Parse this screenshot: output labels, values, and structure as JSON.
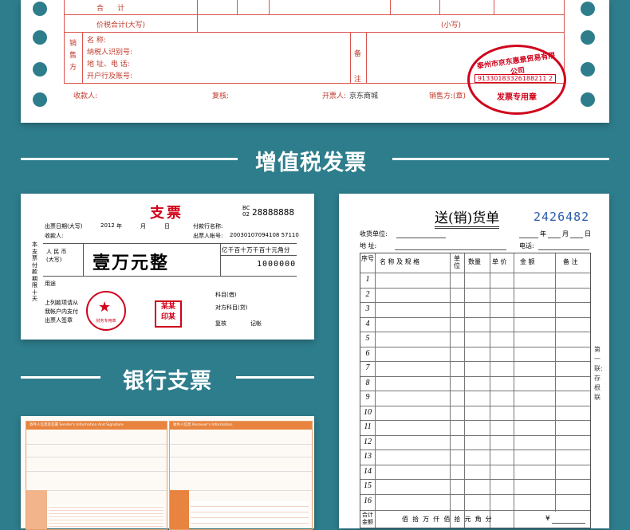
{
  "invoice": {
    "row_total": "合      计",
    "row_tax_total": "价税合计(大写)",
    "row_small": "(小写)",
    "seller_label": [
      "销",
      "售",
      "方"
    ],
    "fields": [
      "名        称:",
      "纳税人识别号:",
      "地  址、电 话:",
      "开户行及账号:"
    ],
    "remark_label": [
      "备",
      "注"
    ],
    "receiver": "收款人:",
    "reviewer": "复核:",
    "issuer": "开票人:",
    "issuer_name": "京东商城",
    "seller_stamp": "销售方:(章)",
    "stamp_top": "泰州市京东惠景贸易有限公司",
    "stamp_id": "91330183326188211 2",
    "stamp_bottom": "发票专用章"
  },
  "section_titles": {
    "vat": "增值税发票",
    "cheque": "银行支票"
  },
  "cheque": {
    "title": "支票",
    "serial_prefix": "BC\n02",
    "serial": "28888888",
    "date_label": "出票日期(大写)",
    "date_year": "2012",
    "date_year_unit": "年",
    "date_month": "月",
    "date_day": "日",
    "bank_label": "付款行名称:",
    "payee_label": "收款人:",
    "account_label": "出票人帐号:",
    "account": "20030107094108 57110",
    "currency": "人 民 币\n(大写)",
    "amount_words": "壹万元整",
    "digit_header": "亿千百十万千百十元角分",
    "amount_digits": "1000000",
    "side_text": "本支票付款期限十天",
    "purpose": "用途",
    "sub_a": "科目(借)",
    "sub_b": "对方科目(贷)",
    "notes": [
      "上列款项请从",
      "我帐户内支付",
      "出票人签章"
    ],
    "review": "复核",
    "bookkeep": "记帐",
    "seal_text": "某某\n印某",
    "round_seal_bottom": "财务专用章"
  },
  "delivery": {
    "title": "送(销)货单",
    "number": "2426482",
    "unit_label": "收货单位:",
    "date_y": "年",
    "date_m": "月",
    "date_d": "日",
    "addr_label": "地    址:",
    "phone_label": "电话:",
    "headers": [
      "序号",
      "名 称 及 规 格",
      "单位",
      "数量",
      "单 价",
      "金   额",
      "备   注"
    ],
    "rows": [
      "1",
      "2",
      "3",
      "4",
      "5",
      "6",
      "7",
      "8",
      "9",
      "10",
      "11",
      "12",
      "13",
      "14",
      "15",
      "16"
    ],
    "total_label": "合计\n金额",
    "total_units": "佰  拾  万  仟  佰  拾  元  角  分",
    "currency_sign": "¥",
    "side_copy": "第一联:存根联"
  },
  "express": {
    "sender_header": "寄件人信息及签署 Sender's Information And Signature",
    "receiver_header": "收件人信息 Receiver's Information"
  }
}
